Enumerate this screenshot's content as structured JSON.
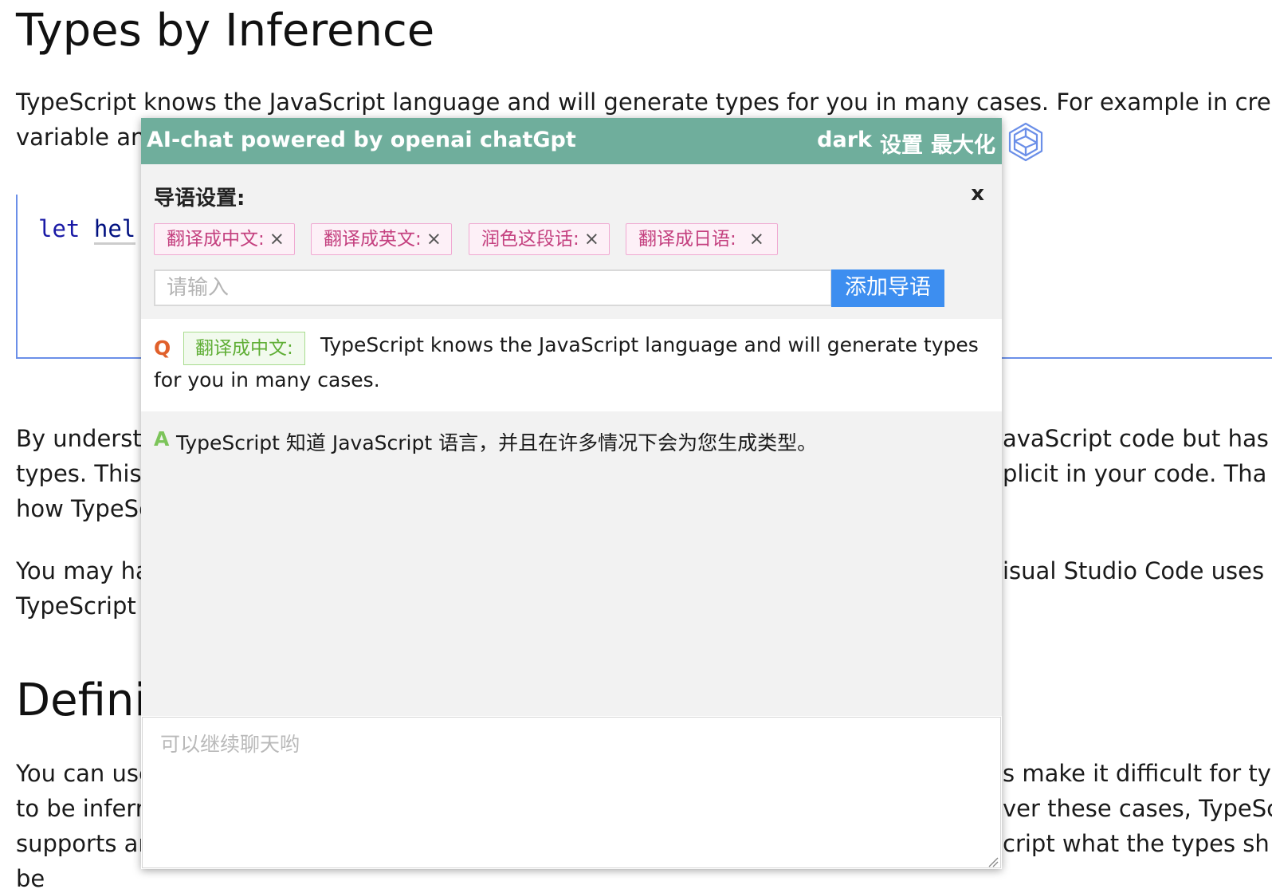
{
  "doc": {
    "h1": "Types by Inference",
    "p1_line1": "TypeScript knows the JavaScript language and will generate types for you in many cases. For example in creating",
    "p1_line2": "variable and",
    "code_keyword": "let",
    "code_ident": "hel",
    "p2_left": [
      "By understa",
      "types. This c",
      "how TypeSc"
    ],
    "p2_right": [
      "avaScript code but has",
      "plicit in your code. Tha",
      ""
    ],
    "p3_left": [
      "You may ha",
      "TypeScript u"
    ],
    "p3_right": [
      "isual Studio Code uses",
      ""
    ],
    "h2": "Definir",
    "p4_left": [
      "You can use",
      "to be inferr",
      "supports ar",
      "be"
    ],
    "p4_right": [
      "s make it difficult for ty",
      "ver these cases, TypeSc",
      "cript what the types sh"
    ]
  },
  "chat": {
    "title": "AI-chat powered by openai chatGpt",
    "actions": {
      "dark": "dark",
      "settings": "设置",
      "maximize": "最大化"
    },
    "logo_icon": "openai-logo-icon",
    "prompt_settings": {
      "title": "导语设置:",
      "close": "x",
      "tags": [
        {
          "label": "翻译成中文:",
          "close": "×"
        },
        {
          "label": "翻译成英文:",
          "close": "×"
        },
        {
          "label": "润色这段话:",
          "close": "×"
        },
        {
          "label": "翻译成日语:",
          "close": "×"
        }
      ],
      "input_placeholder": "请输入",
      "input_value": "",
      "add_button": "添加导语"
    },
    "question": {
      "marker": "Q",
      "tag": "翻译成中文:",
      "text_line1": "TypeScript knows the JavaScript language and will generate types",
      "text_line2": "for you in many cases."
    },
    "answer": {
      "marker": "A",
      "text": "TypeScript 知道 JavaScript 语言，并且在许多情况下会为您生成类型。"
    },
    "input_placeholder": "可以继续聊天哟",
    "input_value": ""
  },
  "colors": {
    "header_bg": "#6fae9c",
    "add_button_bg": "#3d8ef0",
    "tag_text": "#c4407f",
    "q_marker": "#e0602b",
    "a_marker": "#7cc45a"
  }
}
